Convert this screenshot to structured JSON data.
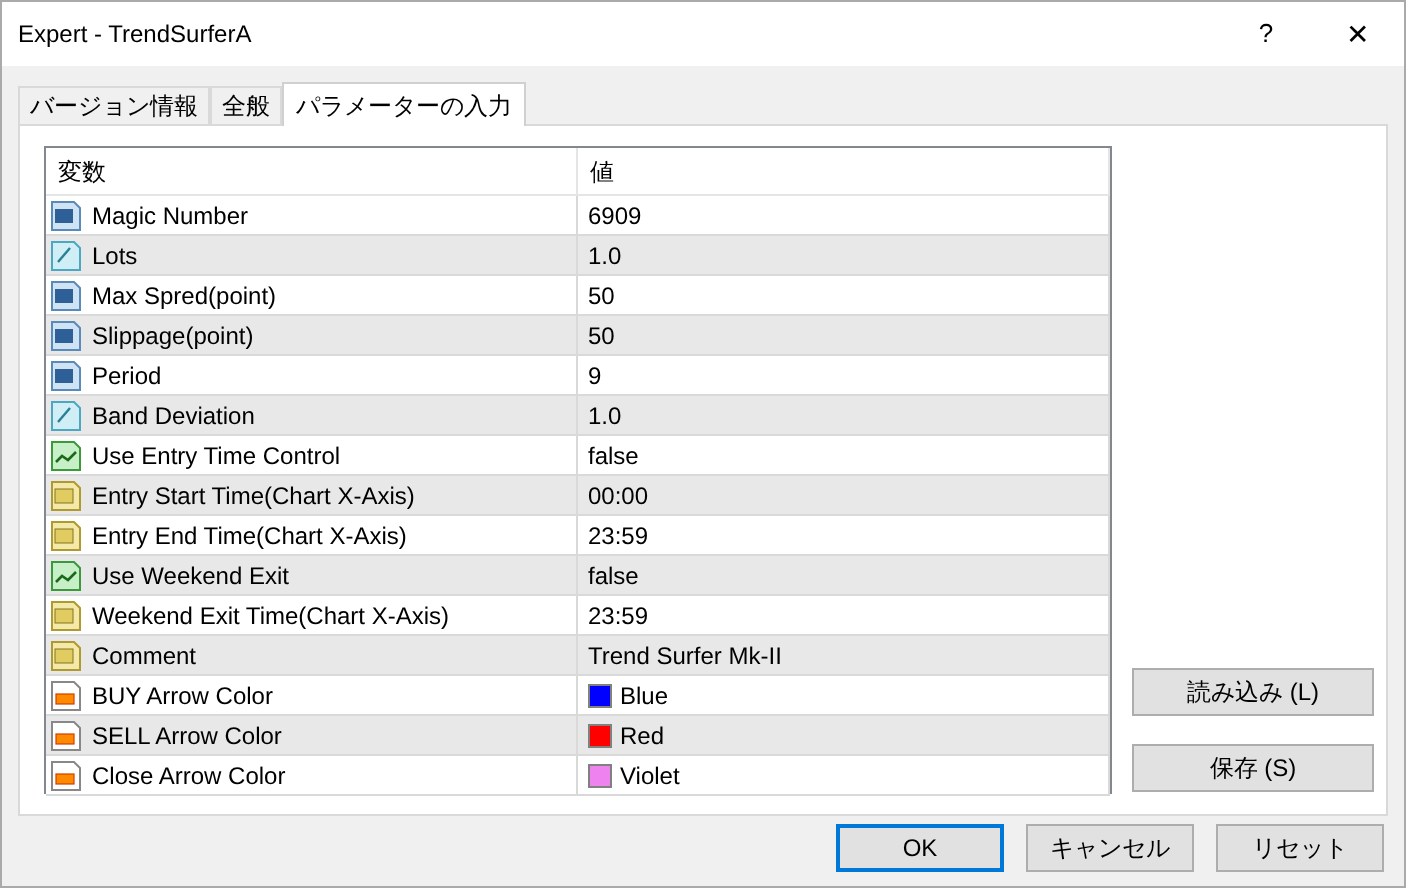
{
  "window": {
    "title": "Expert - TrendSurferA",
    "help": "?",
    "close": "✕"
  },
  "tabs": [
    {
      "label": "バージョン情報",
      "selected": false
    },
    {
      "label": "全般",
      "selected": false
    },
    {
      "label": "パラメーターの入力",
      "selected": true
    }
  ],
  "table": {
    "columns": [
      "変数",
      "値"
    ],
    "rows": [
      {
        "kind": "int",
        "name": "Magic Number",
        "value": "6909"
      },
      {
        "kind": "double",
        "name": "Lots",
        "value": "1.0"
      },
      {
        "kind": "int",
        "name": "Max Spred(point)",
        "value": "50"
      },
      {
        "kind": "int",
        "name": "Slippage(point)",
        "value": "50"
      },
      {
        "kind": "int",
        "name": "Period",
        "value": "9"
      },
      {
        "kind": "double",
        "name": "Band Deviation",
        "value": "1.0"
      },
      {
        "kind": "bool",
        "name": "Use Entry Time Control",
        "value": "false"
      },
      {
        "kind": "string",
        "name": "Entry Start Time(Chart X-Axis)",
        "value": "00:00"
      },
      {
        "kind": "string",
        "name": "Entry End Time(Chart X-Axis)",
        "value": "23:59"
      },
      {
        "kind": "bool",
        "name": "Use Weekend Exit",
        "value": "false"
      },
      {
        "kind": "string",
        "name": "Weekend Exit Time(Chart X-Axis)",
        "value": "23:59"
      },
      {
        "kind": "string",
        "name": "Comment",
        "value": "Trend Surfer Mk-II"
      },
      {
        "kind": "color",
        "name": "BUY Arrow Color",
        "value": "Blue",
        "color": "#0000ff"
      },
      {
        "kind": "color",
        "name": "SELL Arrow Color",
        "value": "Red",
        "color": "#ff0000"
      },
      {
        "kind": "color",
        "name": "Close Arrow Color",
        "value": "Violet",
        "color": "#ee82ee"
      }
    ]
  },
  "side_buttons": [
    "読み込み (L)",
    "保存 (S)"
  ],
  "buttons": [
    {
      "label": "OK",
      "default": true
    },
    {
      "label": "キャンセル",
      "default": false
    },
    {
      "label": "リセット",
      "default": false
    }
  ]
}
